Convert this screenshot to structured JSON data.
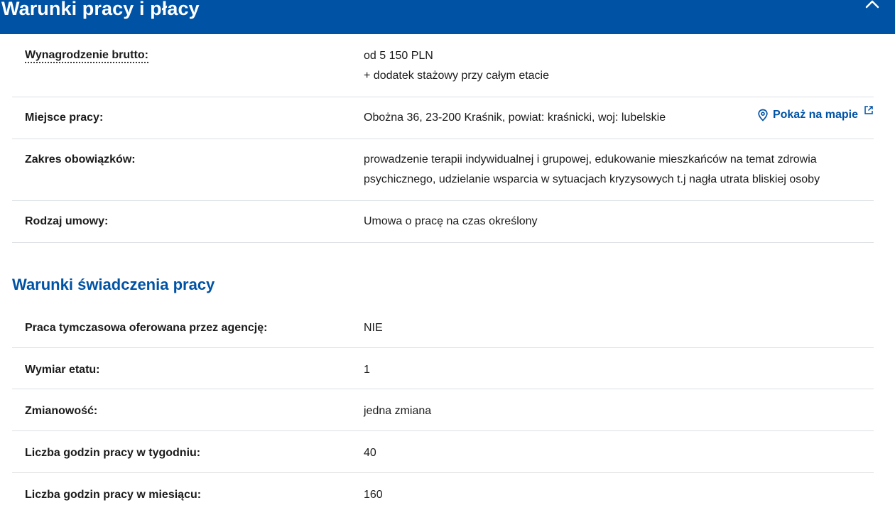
{
  "header": {
    "title": "Warunki pracy i płacy",
    "collapse_icon": "chevron-up-icon",
    "bg_color": "#0052a5"
  },
  "work_conditions": [
    {
      "label": "Wynagrodzenie brutto:",
      "values": [
        "od 5 150 PLN",
        "+ dodatek stażowy przy całym etacie"
      ]
    },
    {
      "label": "Miejsce pracy:",
      "values": [
        "Obożna 36, 23-200 Kraśnik, powiat: kraśnicki, woj: lubelskie"
      ],
      "link": "Pokaż na mapie"
    },
    {
      "label": "Zakres obowiązków:",
      "values": [
        "prowadzenie terapii indywidualnej i grupowej, edukowanie mieszkańców na temat zdrowia",
        "psychicznego, udzielanie wsparcia w sytuacjach kryzysowych t.j nagła utrata bliskiej osoby"
      ]
    },
    {
      "label": "Rodzaj umowy:",
      "values": [
        "Umowa o pracę na czas określony"
      ]
    }
  ],
  "section2": {
    "title": "Warunki świadczenia pracy",
    "rows": [
      {
        "label": "Praca tymczasowa oferowana przez agencję:",
        "value": "NIE"
      },
      {
        "label": "Wymiar etatu:",
        "value": "1"
      },
      {
        "label": "Zmianowość:",
        "value": "jedna zmiana"
      },
      {
        "label": "Liczba godzin pracy w tygodniu:",
        "value": "40"
      },
      {
        "label": "Liczba godzin pracy w miesiącu:",
        "value": "160"
      }
    ]
  },
  "accent_color": "#0052a5"
}
